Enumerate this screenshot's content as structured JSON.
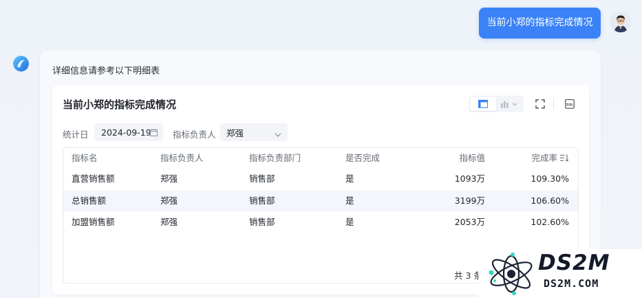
{
  "user_message": "当前小郑的指标完成情况",
  "bot": {
    "intro": "详细信息请参考以下明细表",
    "card": {
      "title": "当前小郑的指标完成情况",
      "filters": {
        "date_label": "统计日",
        "date_value": "2024-09-19",
        "owner_label": "指标负责人",
        "owner_value": "郑强"
      },
      "columns": [
        "指标名",
        "指标负责人",
        "指标负责部门",
        "是否完成",
        "指标值",
        "完成率"
      ],
      "rows": [
        [
          "直营销售额",
          "郑强",
          "销售部",
          "是",
          "1093万",
          "109.30%"
        ],
        [
          "总销售额",
          "郑强",
          "销售部",
          "是",
          "3199万",
          "106.60%"
        ],
        [
          "加盟销售额",
          "郑强",
          "销售部",
          "是",
          "2053万",
          "102.60%"
        ]
      ],
      "footer": "共 3 条"
    }
  },
  "watermark": {
    "logo": "DS2M",
    "site": "DS2M.COM"
  },
  "colors": {
    "accent": "#3b82f6",
    "background": "#eef2f9"
  },
  "icons": [
    "user-avatar-icon",
    "bot-logo-icon",
    "table-view-icon",
    "chart-view-icon",
    "fullscreen-icon",
    "sql-icon",
    "calendar-icon",
    "chevron-down-icon",
    "sort-icon"
  ]
}
